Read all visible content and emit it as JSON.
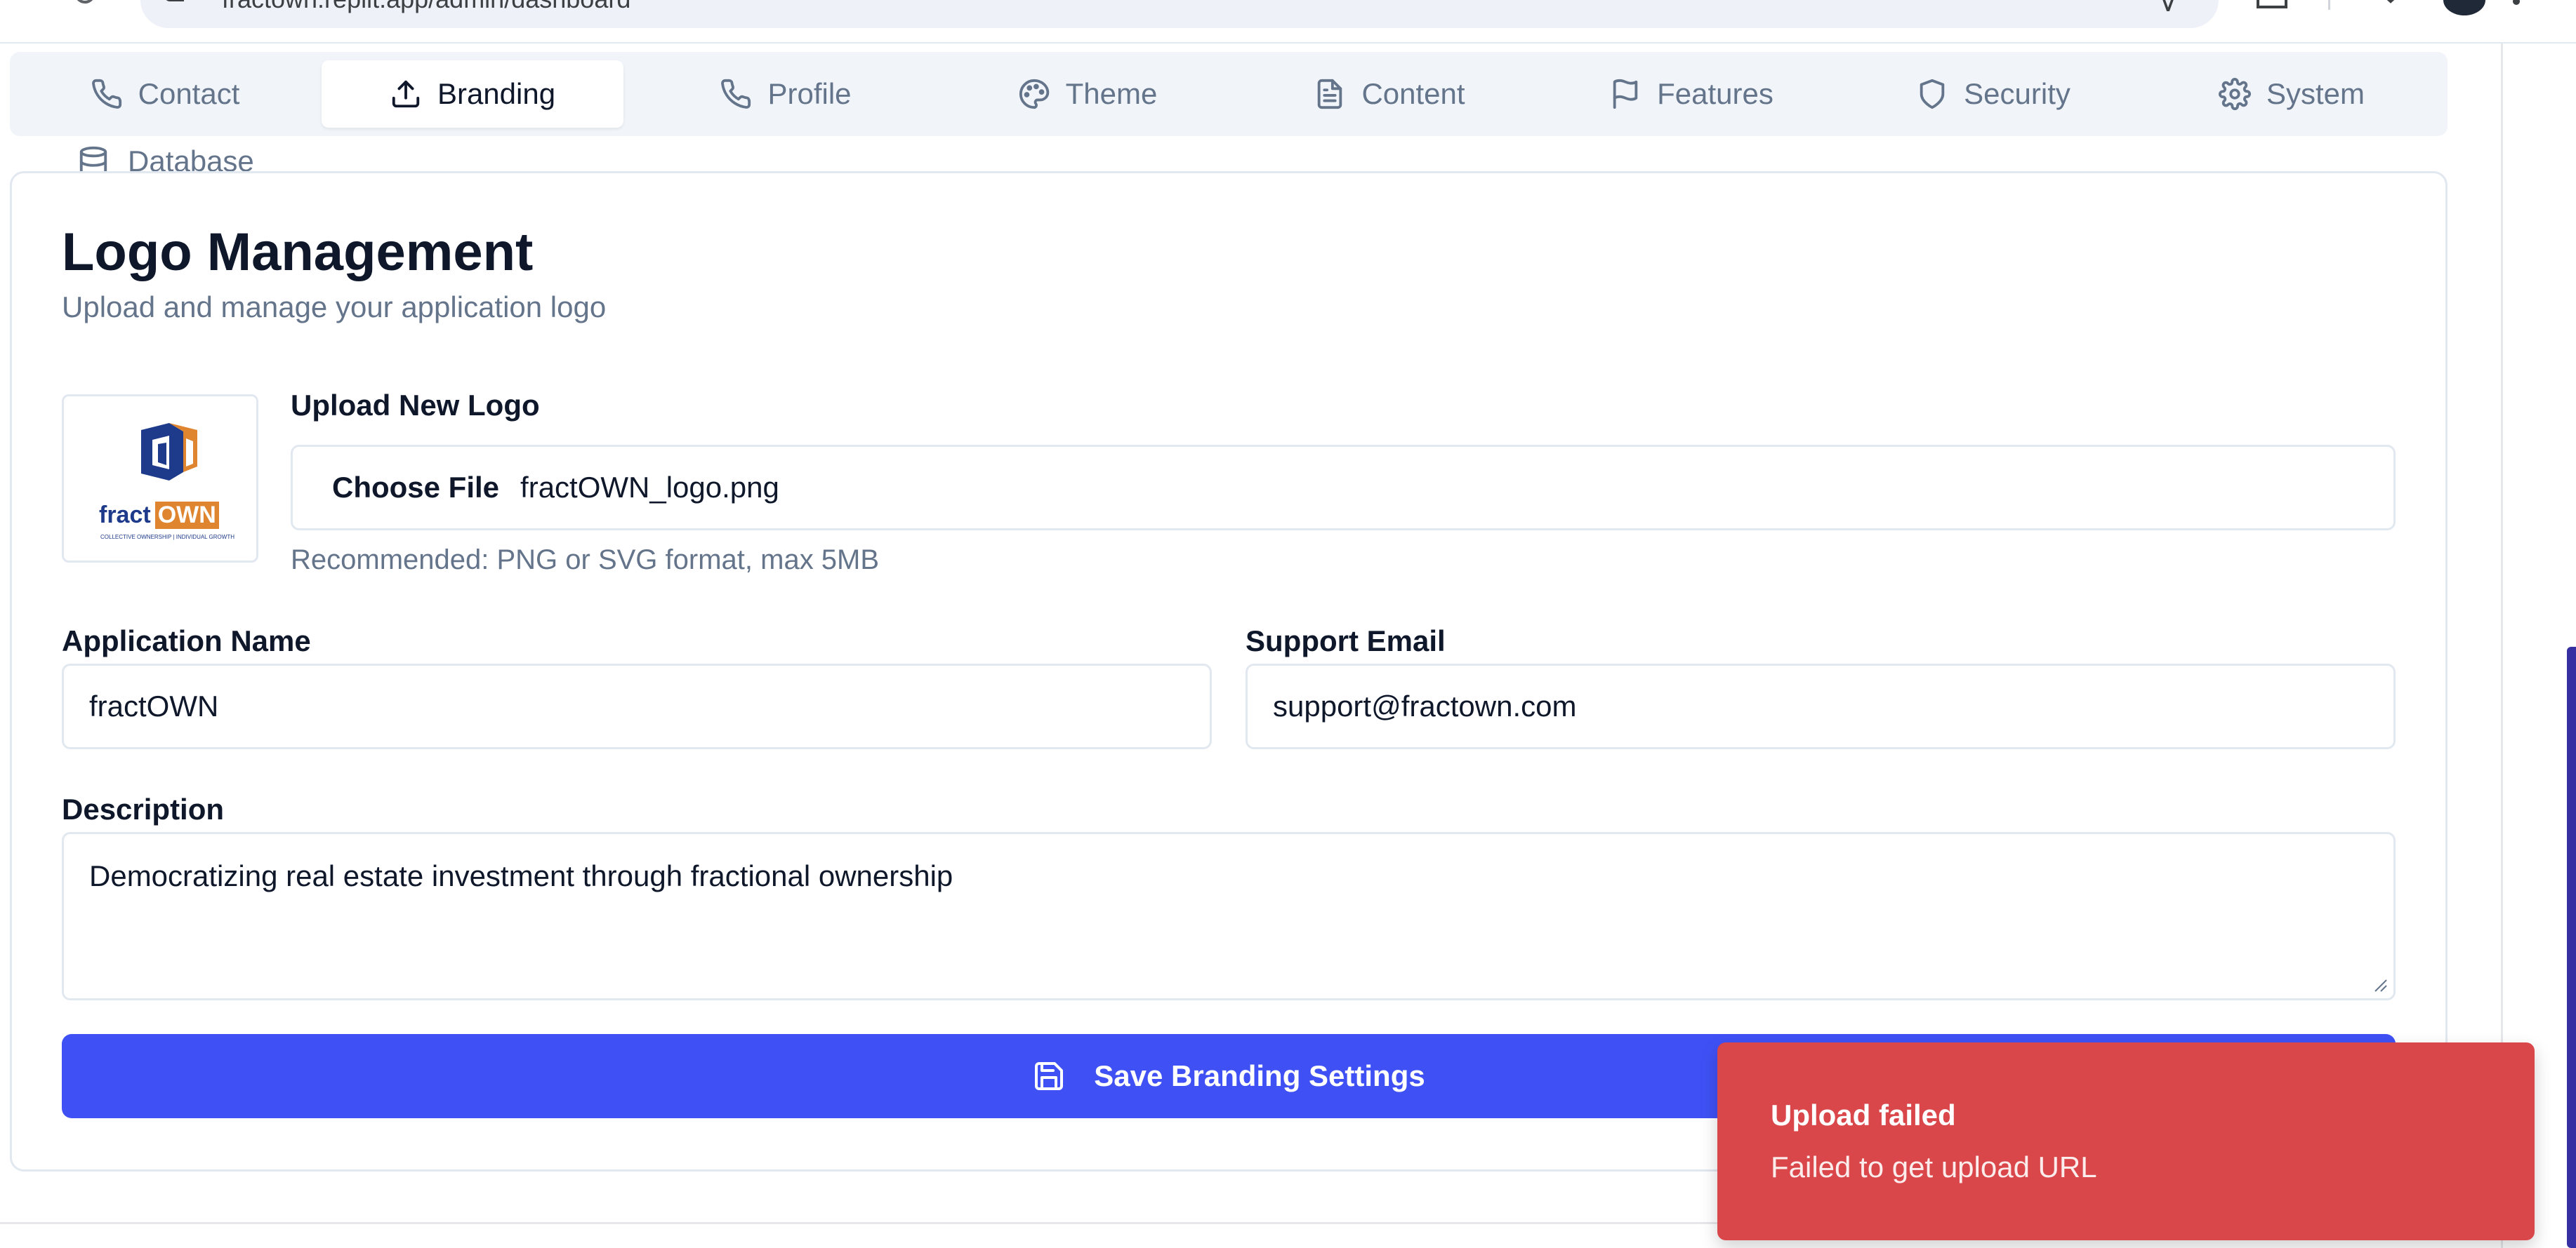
{
  "browser": {
    "url": "fractown.replit.app/admin/dashboard"
  },
  "tabs": [
    {
      "label": "Contact",
      "icon": "phone-icon",
      "active": false
    },
    {
      "label": "Branding",
      "icon": "upload-icon",
      "active": true
    },
    {
      "label": "Profile",
      "icon": "phone-icon",
      "active": false
    },
    {
      "label": "Theme",
      "icon": "palette-icon",
      "active": false
    },
    {
      "label": "Content",
      "icon": "file-text-icon",
      "active": false
    },
    {
      "label": "Features",
      "icon": "flag-icon",
      "active": false
    },
    {
      "label": "Security",
      "icon": "shield-icon",
      "active": false
    },
    {
      "label": "System",
      "icon": "gear-icon",
      "active": false
    },
    {
      "label": "Database",
      "icon": "database-icon",
      "active": false
    }
  ],
  "card": {
    "title": "Logo Management",
    "subtitle": "Upload and manage your application logo",
    "logo": {
      "wordmark_left": "fract",
      "wordmark_right": "OWN",
      "tagline": "COLLECTIVE OWNERSHIP | INDIVIDUAL GROWTH",
      "brand_blue": "#1e3a8a",
      "brand_orange": "#e0852f"
    },
    "upload": {
      "label": "Upload New Logo",
      "button_label": "Choose File",
      "file_name": "fractOWN_logo.png",
      "hint": "Recommended: PNG or SVG format, max 5MB"
    },
    "app_name": {
      "label": "Application Name",
      "value": "fractOWN"
    },
    "support_email": {
      "label": "Support Email",
      "value": "support@fractown.com"
    },
    "description": {
      "label": "Description",
      "value": "Democratizing real estate investment through fractional ownership"
    },
    "save_label": "Save Branding Settings"
  },
  "toast": {
    "title": "Upload failed",
    "message": "Failed to get upload URL",
    "color": "#d9474b"
  },
  "colors": {
    "primary": "#3f51f5",
    "muted_text": "#64748b",
    "border": "#e2e8f0"
  }
}
